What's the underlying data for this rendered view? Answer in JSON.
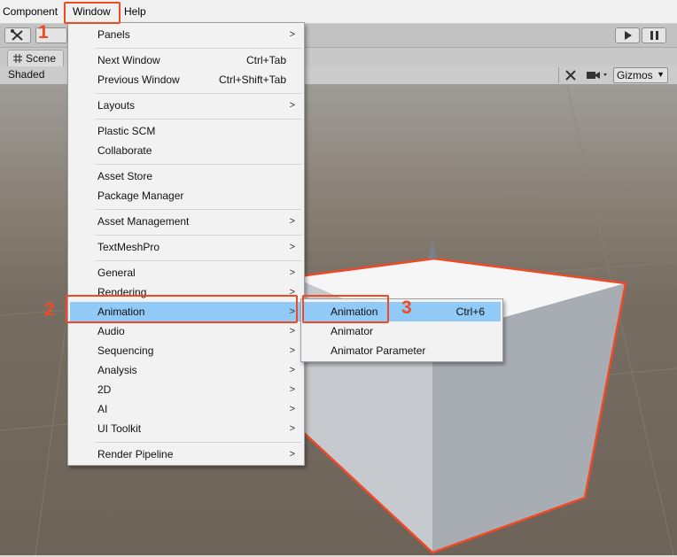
{
  "menubar": {
    "items": [
      "Component",
      "Window",
      "Help"
    ]
  },
  "scene": {
    "tab_label": "Scene",
    "draw_mode": "Shaded",
    "gizmos_label": "Gizmos"
  },
  "window_menu": {
    "groups": [
      [
        {
          "label": "Panels",
          "arrow": true
        }
      ],
      [
        {
          "label": "Next Window",
          "shortcut": "Ctrl+Tab"
        },
        {
          "label": "Previous Window",
          "shortcut": "Ctrl+Shift+Tab"
        }
      ],
      [
        {
          "label": "Layouts",
          "arrow": true
        }
      ],
      [
        {
          "label": "Plastic SCM"
        },
        {
          "label": "Collaborate"
        }
      ],
      [
        {
          "label": "Asset Store"
        },
        {
          "label": "Package Manager"
        }
      ],
      [
        {
          "label": "Asset Management",
          "arrow": true
        }
      ],
      [
        {
          "label": "TextMeshPro",
          "arrow": true
        }
      ],
      [
        {
          "label": "General",
          "arrow": true
        },
        {
          "label": "Rendering",
          "arrow": true
        },
        {
          "label": "Animation",
          "arrow": true,
          "highlighted": true
        },
        {
          "label": "Audio",
          "arrow": true
        },
        {
          "label": "Sequencing",
          "arrow": true
        },
        {
          "label": "Analysis",
          "arrow": true
        },
        {
          "label": "2D",
          "arrow": true
        },
        {
          "label": "AI",
          "arrow": true
        },
        {
          "label": "UI Toolkit",
          "arrow": true
        }
      ],
      [
        {
          "label": "Render Pipeline",
          "arrow": true
        }
      ]
    ]
  },
  "animation_submenu": {
    "items": [
      {
        "label": "Animation",
        "shortcut": "Ctrl+6",
        "highlighted": true
      },
      {
        "label": "Animator"
      },
      {
        "label": "Animator Parameter"
      }
    ]
  },
  "annotations": {
    "step1": "1",
    "step2": "2",
    "step3": "3",
    "color": "#ef4a25"
  },
  "colors": {
    "menu_highlight": "#91c9f7",
    "cube_outline": "#ef4a25"
  },
  "icons": [
    "tools-icon",
    "scene-grid-icon",
    "play-icon",
    "pause-icon",
    "move-tool-icon",
    "camera-icon",
    "dropdown-arrow-icon",
    "submenu-arrow-icon"
  ]
}
